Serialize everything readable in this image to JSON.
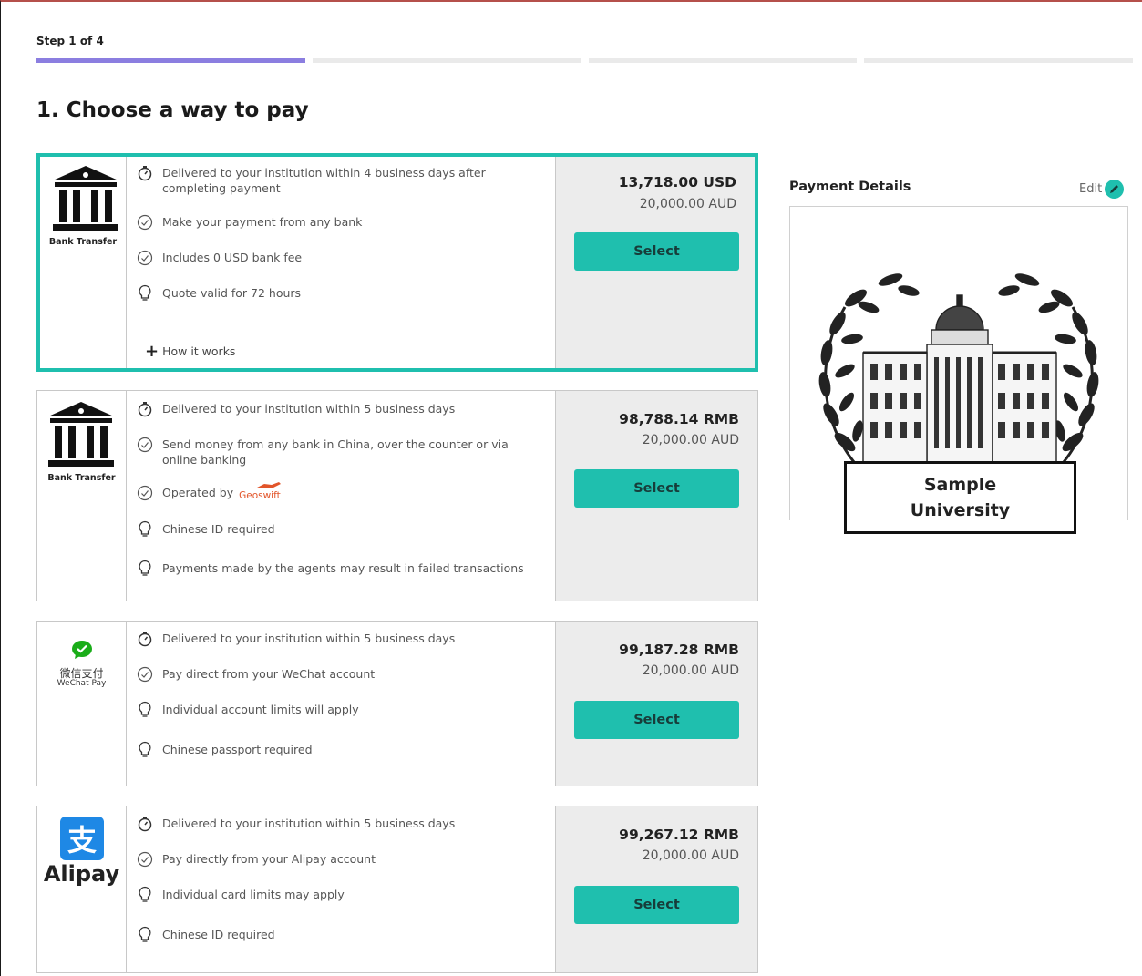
{
  "step": {
    "label": "Step 1 of 4",
    "current": 1,
    "total": 4
  },
  "page_title": "1. Choose a way to pay",
  "methods": [
    {
      "logo_caption": "Bank Transfer",
      "features": [
        {
          "icon": "timer-icon",
          "text": "Delivered to your institution within 4 business days after completing payment"
        },
        {
          "icon": "check-circle-icon",
          "text": "Make your payment from any bank"
        },
        {
          "icon": "check-circle-icon",
          "text": "Includes 0 USD bank fee"
        },
        {
          "icon": "lightbulb-icon",
          "text": "Quote valid for 72 hours"
        }
      ],
      "how_it_works": "How it works",
      "price": "13,718.00 USD",
      "amount": "20,000.00 AUD",
      "select_label": "Select"
    },
    {
      "logo_caption": "Bank Transfer",
      "features": [
        {
          "icon": "timer-icon",
          "text": "Delivered to your institution within 5 business days"
        },
        {
          "icon": "check-circle-icon",
          "text": "Send money from any bank in China, over the counter or via online banking"
        },
        {
          "icon": "check-circle-icon",
          "text": "Operated by"
        },
        {
          "icon": "lightbulb-icon",
          "text": "Chinese ID required"
        },
        {
          "icon": "lightbulb-icon",
          "text": "Payments made by the agents may result in failed transactions"
        }
      ],
      "operator_logo": "Geoswift",
      "price": "98,788.14 RMB",
      "amount": "20,000.00 AUD",
      "select_label": "Select"
    },
    {
      "logo_caption_cn": "微信支付",
      "logo_caption": "WeChat Pay",
      "features": [
        {
          "icon": "timer-icon",
          "text": "Delivered to your institution within 5 business days"
        },
        {
          "icon": "check-circle-icon",
          "text": "Pay direct from your WeChat account"
        },
        {
          "icon": "lightbulb-icon",
          "text": "Individual account limits will apply"
        },
        {
          "icon": "lightbulb-icon",
          "text": "Chinese passport required"
        }
      ],
      "price": "99,187.28 RMB",
      "amount": "20,000.00 AUD",
      "select_label": "Select"
    },
    {
      "logo_caption": "Alipay",
      "logo_glyph": "支",
      "features": [
        {
          "icon": "timer-icon",
          "text": "Delivered to your institution within 5 business days"
        },
        {
          "icon": "check-circle-icon",
          "text": "Pay directly from your Alipay account"
        },
        {
          "icon": "lightbulb-icon",
          "text": "Individual card limits may apply"
        },
        {
          "icon": "lightbulb-icon",
          "text": "Chinese ID required"
        }
      ],
      "price": "99,267.12 RMB",
      "amount": "20,000.00 AUD",
      "select_label": "Select"
    }
  ],
  "payment_details": {
    "title": "Payment Details",
    "edit_label": "Edit",
    "university_line1": "Sample",
    "university_line2": "University"
  },
  "colors": {
    "accent": "#1fbfae",
    "progress": "#8b7ee0",
    "price_bg": "#ececec"
  }
}
